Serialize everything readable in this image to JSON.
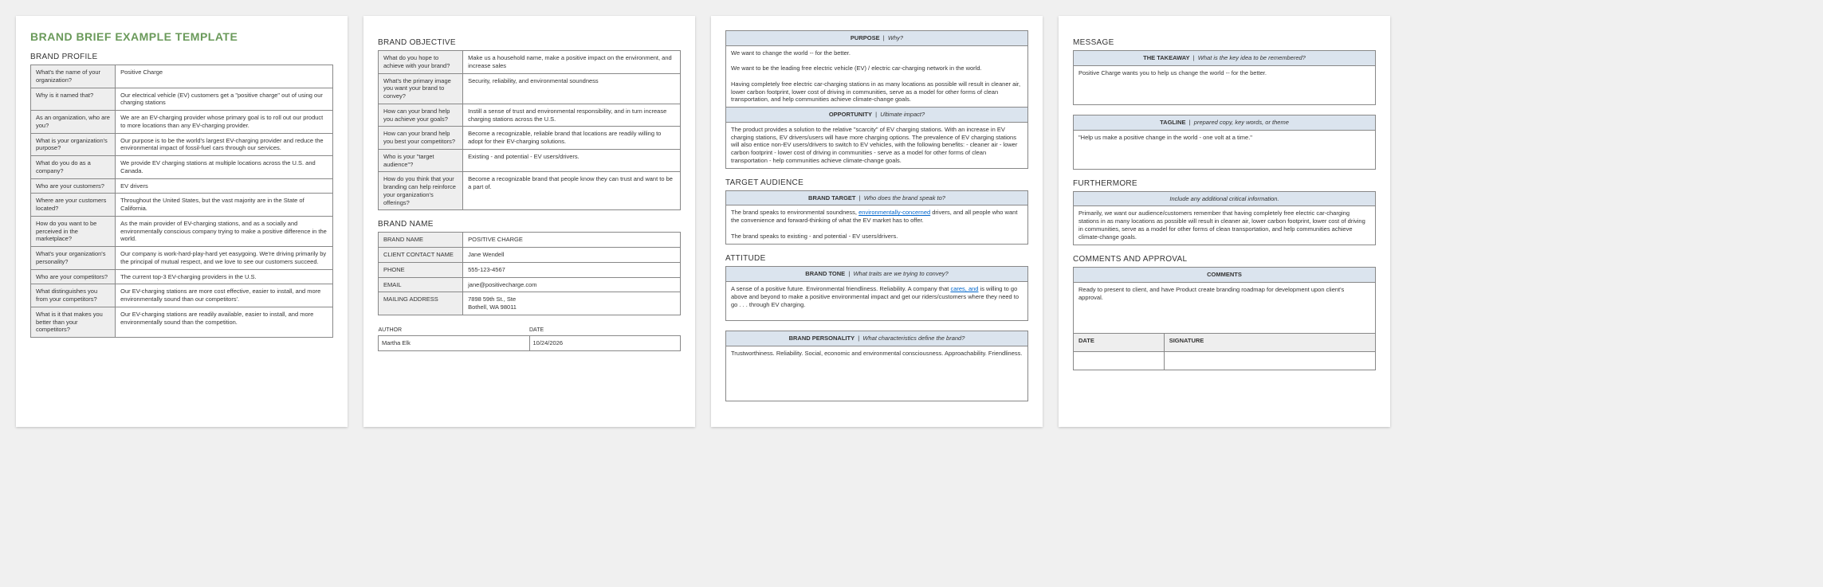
{
  "page1": {
    "title": "BRAND BRIEF EXAMPLE TEMPLATE",
    "profile_heading": "BRAND PROFILE",
    "profile": [
      {
        "q": "What's the name of your organization?",
        "a": "Positive Charge"
      },
      {
        "q": "Why is it named that?",
        "a": "Our electrical vehicle (EV) customers get a \"positive charge\" out of using our charging stations"
      },
      {
        "q": "As an organization, who are you?",
        "a": "We are an EV-charging provider whose primary goal is to roll out our product to more locations than any EV-charging provider."
      },
      {
        "q": "What is your organization's purpose?",
        "a": "Our purpose is to be the world's largest EV-charging provider and reduce the environmental impact of fossil-fuel cars through our services."
      },
      {
        "q": "What do you do as a company?",
        "a": "We provide EV charging stations at multiple locations across the U.S. and Canada."
      },
      {
        "q": "Who are your customers?",
        "a": "EV drivers"
      },
      {
        "q": "Where are your customers located?",
        "a": "Throughout the United States, but the vast majority are in the State of California."
      },
      {
        "q": "How do you want to be perceived in the marketplace?",
        "a": "As the main provider of EV-charging stations, and as a socially and environmentally conscious company trying to make a positive difference in the world."
      },
      {
        "q": "What's your organization's personality?",
        "a": "Our company is work-hard-play-hard yet easygoing. We're driving primarily by the principal of mutual respect, and we love to see our customers succeed."
      },
      {
        "q": "Who are your competitors?",
        "a": "The current top-3 EV-charging providers in the U.S."
      },
      {
        "q": "What distinguishes you from your competitors?",
        "a": "Our EV-charging stations are more cost effective, easier to install, and more environmentally sound than our competitors'."
      },
      {
        "q": "What is it that makes you better than your competitors?",
        "a": "Our EV-charging stations are readily available, easier to install, and more environmentally sound than the competition."
      }
    ]
  },
  "page2": {
    "objective_heading": "BRAND OBJECTIVE",
    "objective": [
      {
        "q": "What do you hope to achieve with your brand?",
        "a": "Make us a household name, make a positive impact on the environment, and increase sales"
      },
      {
        "q": "What's the primary image you want your brand to convey?",
        "a": "Security, reliability, and environmental soundness"
      },
      {
        "q": "How can your brand help you achieve your goals?",
        "a": "Instill a sense of trust and environmental responsibility, and in turn increase charging stations across the U.S."
      },
      {
        "q": "How can your brand help you best your competitors?",
        "a": "Become a recognizable, reliable brand that locations are readily willing to adopt for their EV-charging solutions."
      },
      {
        "q": "Who is your \"target audience\"?",
        "a": "Existing - and potential - EV users/drivers."
      },
      {
        "q": "How do you think that your branding can help reinforce your organization's offerings?",
        "a": "Become a recognizable brand that people know they can trust and want to be a part of."
      }
    ],
    "name_heading": "BRAND NAME",
    "name": [
      {
        "q": "BRAND NAME",
        "a": "POSITIVE CHARGE"
      },
      {
        "q": "CLIENT CONTACT NAME",
        "a": "Jane Wendell"
      },
      {
        "q": "PHONE",
        "a": "555-123-4567"
      },
      {
        "q": "EMAIL",
        "a": "jane@positivecharge.com"
      },
      {
        "q": "MAILING ADDRESS",
        "a": "7898 59th St., Ste\nBothell, WA 98011"
      }
    ],
    "author_label": "AUTHOR",
    "date_label": "DATE",
    "author": "Martha Elk",
    "date": "10/24/2026"
  },
  "page3": {
    "purpose": {
      "header_label": "PURPOSE",
      "header_sub": "Why?",
      "text": "We want to change the world -- for the better.\n\nWe want to be the leading free electric vehicle (EV) / electric car-charging network in the world.\n\nHaving completely free electric car-charging stations in as many locations as possible will result in cleaner air, lower carbon footprint, lower cost of driving in communities, serve as a model for other forms of clean transportation, and help communities achieve climate-change goals."
    },
    "opportunity": {
      "header_label": "OPPORTUNITY",
      "header_sub": "Ultimate impact?",
      "text": "The product provides a solution to the relative \"scarcity\" of EV charging stations. With an increase in EV charging stations, EV drivers/users will have more charging options. The prevalence of EV charging stations will also entice non-EV users/drivers to switch to EV vehicles, with the following benefits: - cleaner air - lower carbon footprint - lower cost of driving in communities - serve as a model for other forms of clean transportation - help communities achieve climate-change goals."
    },
    "audience_heading": "TARGET AUDIENCE",
    "audience": {
      "header_label": "BRAND TARGET",
      "header_sub": "Who does the brand speak to?",
      "text_before": "The brand speaks to environmental soundness, ",
      "link_text": "environmentally-concerned",
      "text_after": " drivers, and all people who want the convenience and forward-thinking of what the EV market has to offer.\n\nThe brand speaks to existing - and potential - EV users/drivers."
    },
    "attitude_heading": "ATTITUDE",
    "tone": {
      "header_label": "BRAND TONE",
      "header_sub": "What traits are we trying to convey?",
      "text_before": "A sense of a positive future. Environmental friendliness. Reliability. A company that ",
      "link_text": "cares, and",
      "text_after": " is willing to go above and beyond to make a positive environmental impact and get our riders/customers where they need to go . . . through EV charging."
    },
    "personality": {
      "header_label": "BRAND PERSONALITY",
      "header_sub": "What characteristics define the brand?",
      "text": "Trustworthiness. Reliability. Social, economic and environmental consciousness. Approachability. Friendliness."
    }
  },
  "page4": {
    "message_heading": "MESSAGE",
    "takeaway": {
      "header_label": "THE TAKEAWAY",
      "header_sub": "What is the key idea to be remembered?",
      "text": "Positive Charge wants you to help us change the world -- for the better."
    },
    "tagline": {
      "header_label": "TAGLINE",
      "header_sub": "prepared copy, key words, or theme",
      "text": "\"Help us make a positive change in the world - one volt at a time.\""
    },
    "furthermore_heading": "FURTHERMORE",
    "furthermore": {
      "header_sub": "Include any additional critical information.",
      "text": "Primarily, we want our audience/customers remember that having completely free electric car-charging stations in as many locations as possible will result in cleaner air, lower carbon footprint, lower cost of driving in communities, serve as a model for other forms of clean transportation, and help communities achieve climate-change goals."
    },
    "comments_heading": "COMMENTS AND APPROVAL",
    "comments": {
      "header_label": "COMMENTS",
      "text": "Ready to present to client, and have Product create branding roadmap for development upon client's approval."
    },
    "date_label": "DATE",
    "signature_label": "SIGNATURE"
  }
}
